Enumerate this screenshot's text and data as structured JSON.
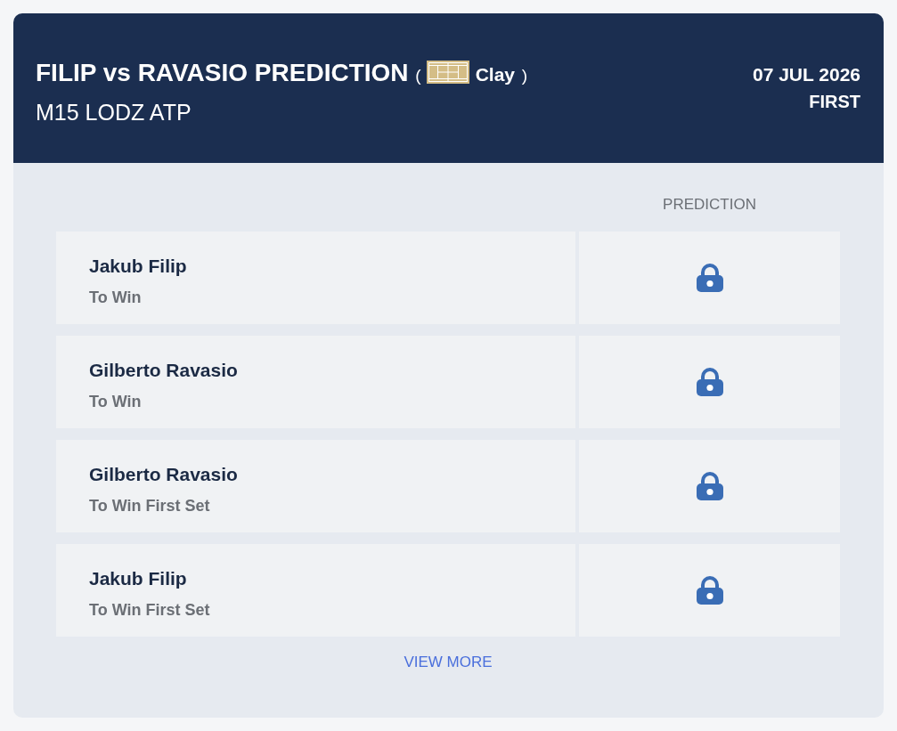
{
  "header": {
    "title": "FILIP vs RAVASIO PREDICTION",
    "surface": {
      "open": "(",
      "name": "Clay",
      "close": ")"
    },
    "tournament": "M15 LODZ ATP",
    "date": "07 JUL 2026",
    "round": "FIRST"
  },
  "table": {
    "prediction_heading": "PREDICTION",
    "rows": [
      {
        "player": "Jakub Filip",
        "market": "To Win",
        "locked": true
      },
      {
        "player": "Gilberto Ravasio",
        "market": "To Win",
        "locked": true
      },
      {
        "player": "Gilberto Ravasio",
        "market": "To Win First Set",
        "locked": true
      },
      {
        "player": "Jakub Filip",
        "market": "To Win First Set",
        "locked": true
      }
    ]
  },
  "view_more": "VIEW MORE"
}
